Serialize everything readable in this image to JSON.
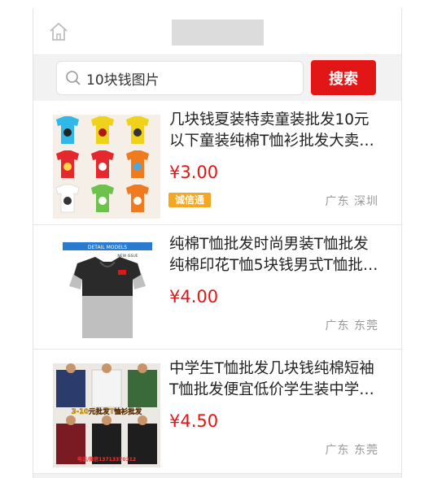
{
  "search": {
    "value": "10块钱图片",
    "button_label": "搜索"
  },
  "products": [
    {
      "name": "几块钱夏装特卖童装批发10元以下童装纯棉T恤衫批发大卖…",
      "price": "¥3.00",
      "badge": "诚信通",
      "location": "广东 深圳"
    },
    {
      "name": "纯棉T恤批发时尚男装T恤批发纯棉印花T恤5块钱男式T恤批…",
      "price": "¥4.00",
      "location": "广东 东莞",
      "image_text": {
        "heading": "DETAIL MODELS",
        "sub": "NEW ISSUE"
      }
    },
    {
      "name": "中学生T恤批发几块钱纯棉短袖T恤批发便宜低价学生装中学…",
      "price": "¥4.50",
      "location": "广东 东莞",
      "image_text": {
        "banner": "3-10元批发T恤衫批发",
        "phone": "电话/微信13713370312"
      }
    }
  ],
  "colors": {
    "accent": "#e21616",
    "badge": "#f5a623"
  }
}
